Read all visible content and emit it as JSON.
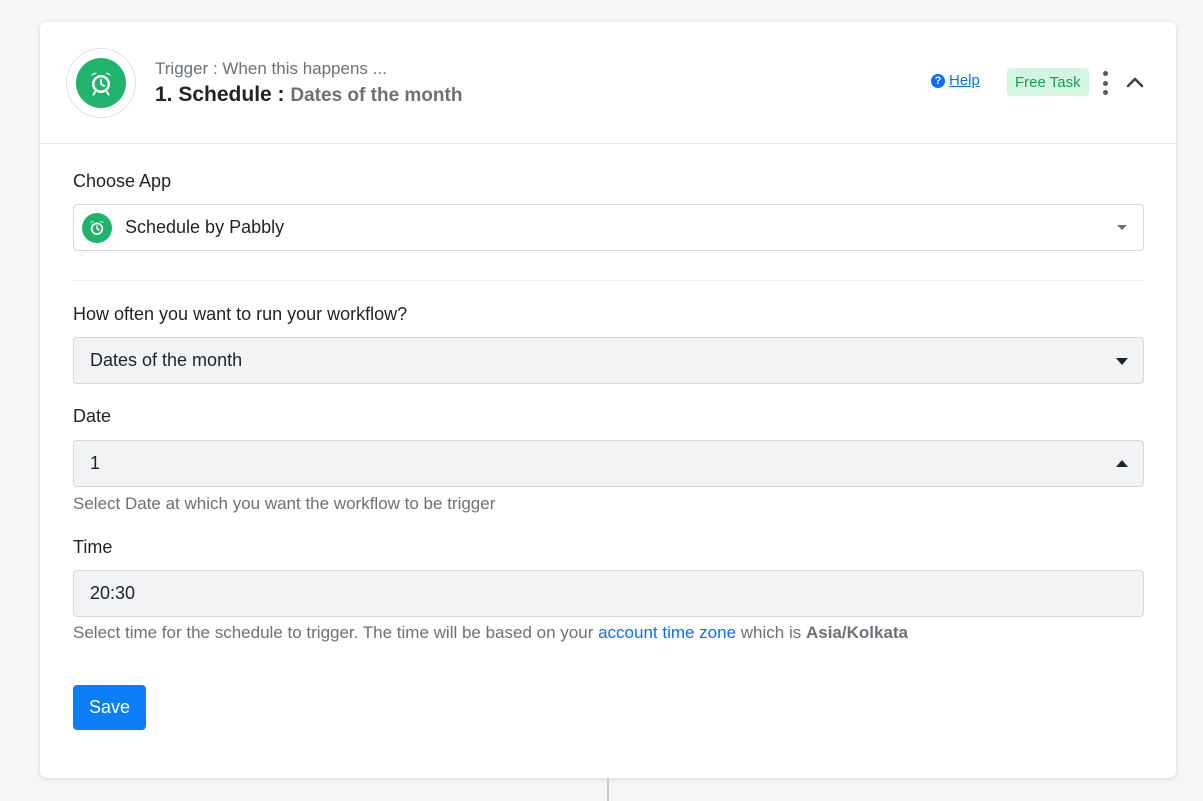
{
  "header": {
    "subtitle": "Trigger : When this happens ...",
    "title_prefix": "1. Schedule :",
    "title_event": "Dates of the month",
    "help_label": "Help",
    "help_icon": "?",
    "badge_label": "Free Task"
  },
  "choose_app": {
    "label": "Choose App",
    "value": "Schedule by Pabbly"
  },
  "frequency": {
    "label": "How often you want to run your workflow?",
    "value": "Dates of the month"
  },
  "date": {
    "label": "Date",
    "value": "1",
    "hint": "Select Date at which you want the workflow to be trigger"
  },
  "time": {
    "label": "Time",
    "value": "20:30",
    "hint_prefix": "Select time for the schedule to trigger. The time will be based on your ",
    "hint_link": "account time zone",
    "hint_middle": " which is ",
    "hint_timezone": "Asia/Kolkata"
  },
  "actions": {
    "save_label": "Save"
  },
  "colors": {
    "brand_green": "#1fb36b",
    "primary_blue": "#0d7ef8",
    "badge_bg": "#d4f5e3",
    "badge_text": "#1a9a5a"
  }
}
